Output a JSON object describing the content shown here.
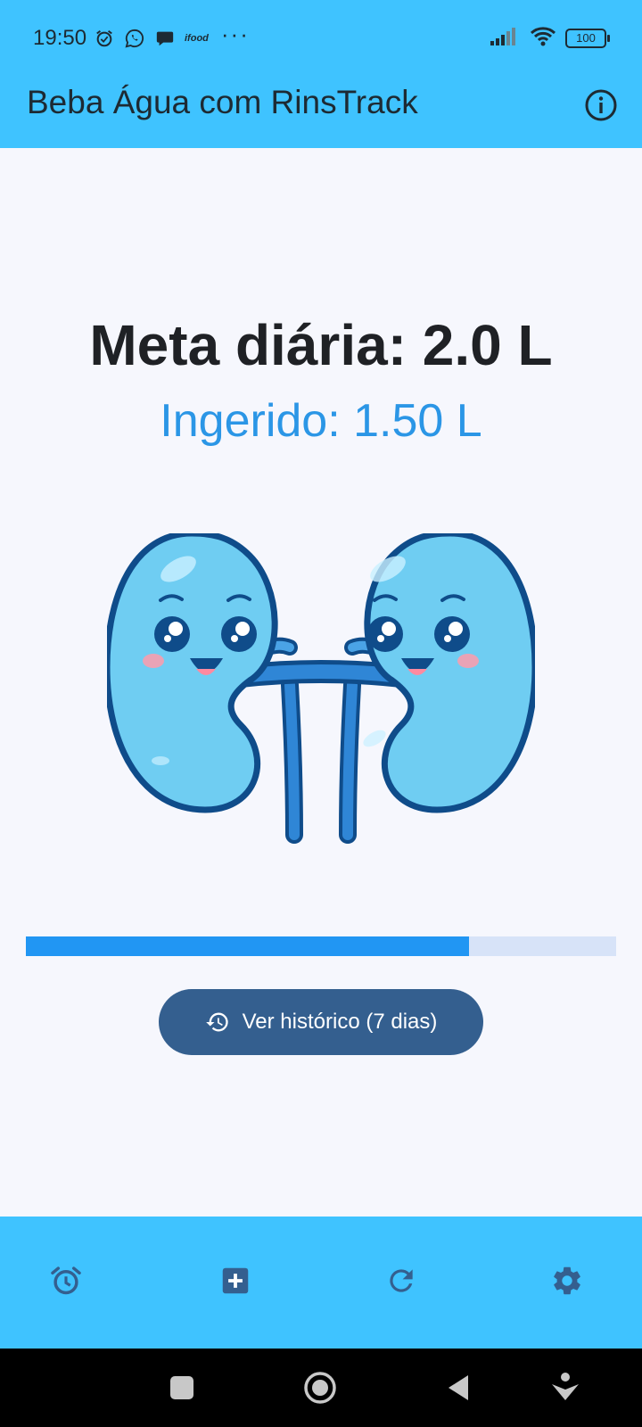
{
  "status_bar": {
    "time": "19:50",
    "ifood_label": "ifood",
    "more": "···",
    "battery": "100"
  },
  "app_bar": {
    "title": "Beba Água com RinsTrack",
    "info_icon": "info-icon"
  },
  "main": {
    "goal_text": "Meta diária: 2.0 L",
    "intake_text": "Ingerido: 1.50 L",
    "progress_fraction": 0.75,
    "history_button_label": "Ver histórico (7 dias)",
    "history_icon": "history-icon"
  },
  "bottom_nav": {
    "items": [
      "alarm-icon",
      "add-box-icon",
      "refresh-icon",
      "settings-icon"
    ]
  },
  "system_nav": {
    "items": [
      "recents-button",
      "home-button",
      "back-button",
      "assist-button"
    ]
  },
  "colors": {
    "appbar": "#3fc3ff",
    "accent": "#2196f3",
    "button": "#345f8f",
    "background": "#f6f7fd"
  }
}
